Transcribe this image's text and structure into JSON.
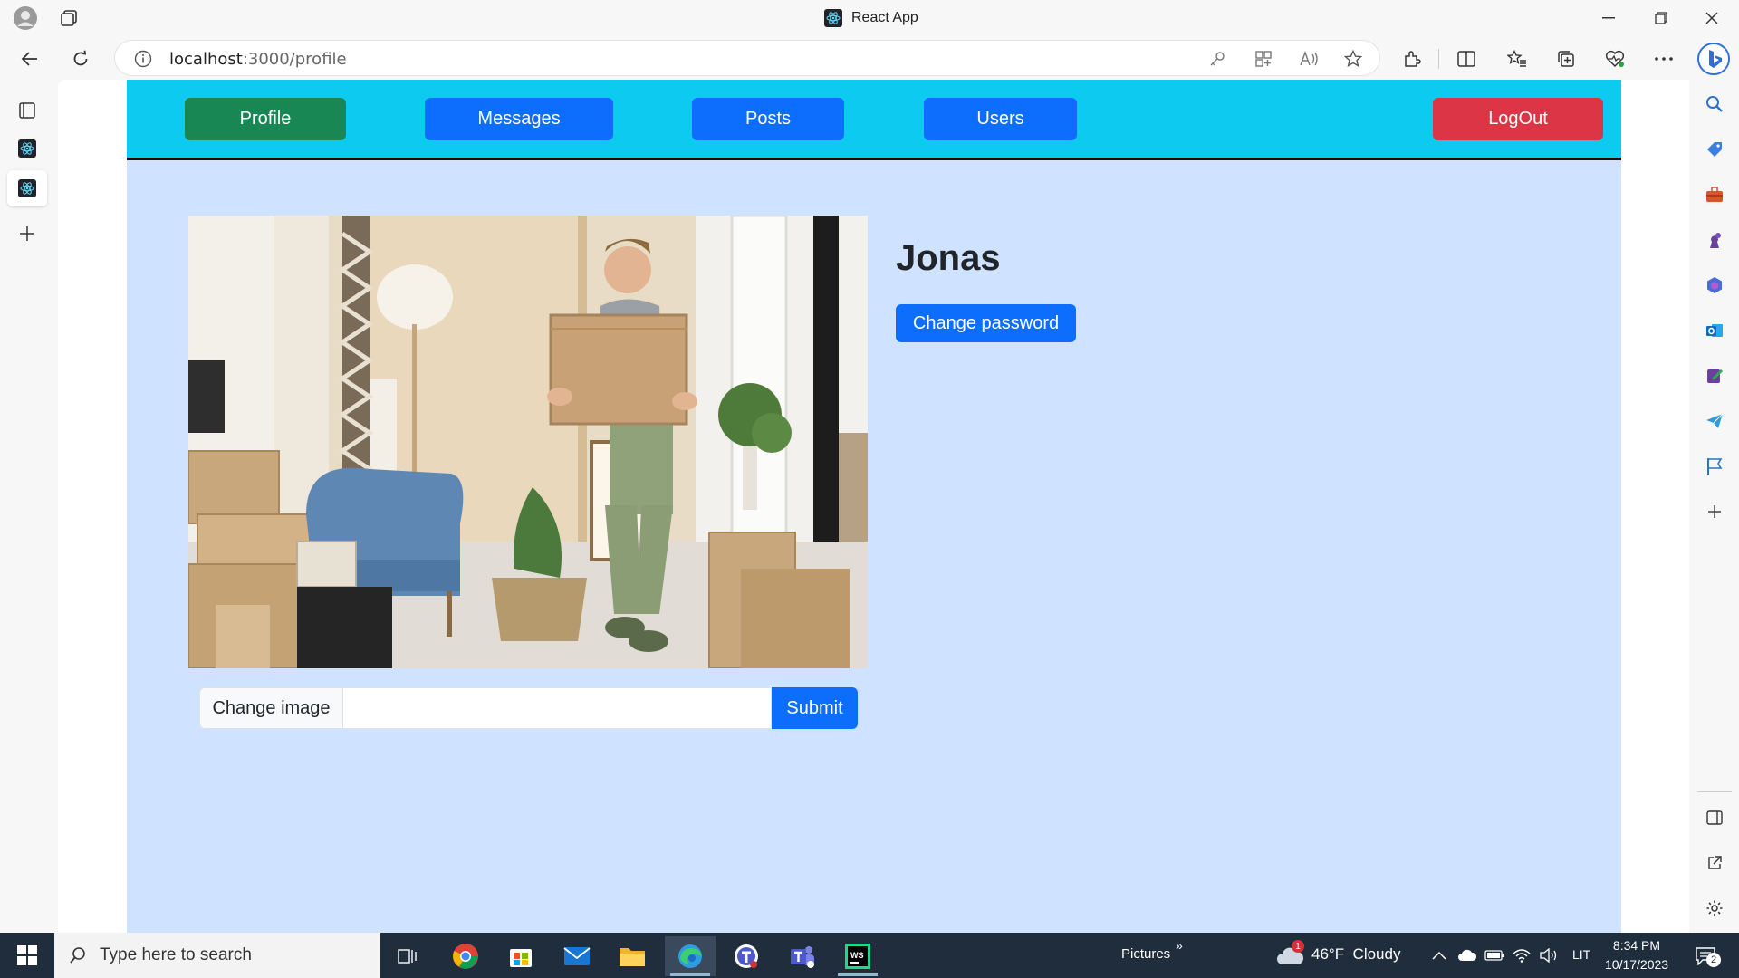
{
  "window": {
    "title": "React App"
  },
  "browser": {
    "url_host": "localhost",
    "url_path": ":3000/profile"
  },
  "nav": {
    "profile": "Profile",
    "messages": "Messages",
    "posts": "Posts",
    "users": "Users",
    "logout": "LogOut"
  },
  "profile": {
    "name": "Jonas",
    "change_password": "Change password",
    "change_image_label": "Change image",
    "file_value": "",
    "submit": "Submit"
  },
  "taskbar": {
    "search_placeholder": "Type here to search",
    "folder_label": "Pictures",
    "weather": "46°F  Cloudy",
    "weather_badge": "1",
    "language": "LIT",
    "time": "8:34 PM",
    "date": "10/17/2023",
    "notification_count": "2"
  },
  "colors": {
    "navbar": "#0dcaf0",
    "primary": "#0d6efd",
    "success": "#198754",
    "danger": "#dc3545",
    "page_bg": "#cfe2ff"
  }
}
